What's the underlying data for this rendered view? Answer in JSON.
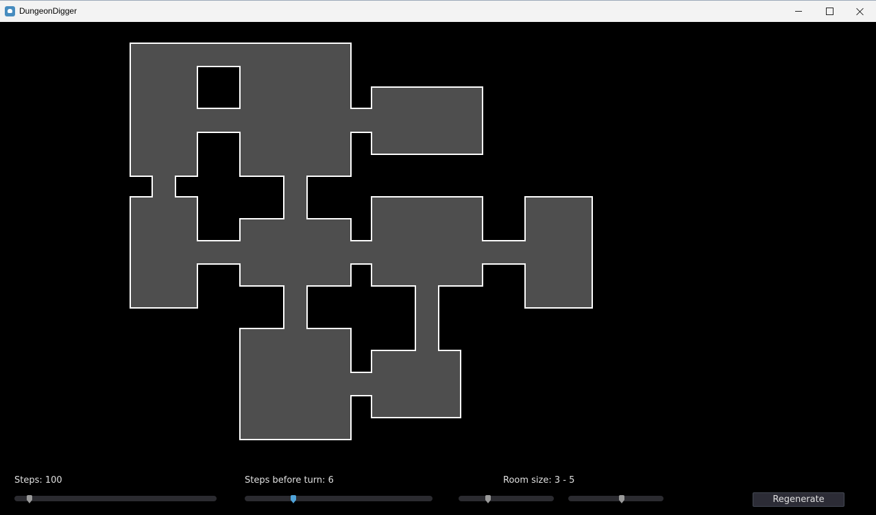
{
  "window": {
    "title": "DungeonDigger",
    "icon": "godot-icon"
  },
  "controls": {
    "steps": {
      "label": "Steps: 100",
      "value": 100,
      "position": 0.075
    },
    "steps_before_turn": {
      "label": "Steps before turn: 6",
      "value": 6,
      "position": 0.26
    },
    "room_size": {
      "label": "Room size: 3 - 5",
      "min": {
        "value": 3,
        "position": 0.31
      },
      "max": {
        "value": 5,
        "position": 0.56
      }
    },
    "regenerate_label": "Regenerate"
  },
  "colors": {
    "floor": "#4e4e4e",
    "wall_outline": "#ffffff",
    "background": "#000000",
    "active_grabber": "#4fa3d9",
    "grabber": "#9a9a9a"
  }
}
